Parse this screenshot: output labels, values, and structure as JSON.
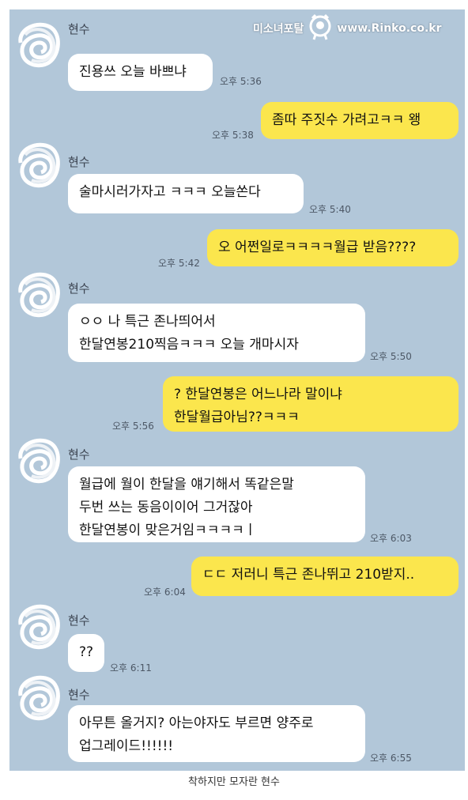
{
  "watermark": {
    "site": "미소녀포탈",
    "url": "www.Rinko.co.kr",
    "icon": "mascot-face-icon"
  },
  "colors": {
    "background": "#b2c7d9",
    "incoming": "#ffffff",
    "outgoing": "#fbe64d"
  },
  "messages": [
    {
      "sender": "현수",
      "text": "진용쓰 오늘 바쁘냐",
      "time": "오후 5:36"
    },
    {
      "text": "좀따 주짓수 가려고ㅋㅋ 왱",
      "time": "오후 5:38"
    },
    {
      "sender": "현수",
      "text": "술마시러가자고 ㅋㅋㅋ 오늘쏜다",
      "time": "오후 5:40"
    },
    {
      "text": "오 어쩐일로ㅋㅋㅋㅋ월급 받음????",
      "time": "오후 5:42"
    },
    {
      "sender": "현수",
      "text": "ㅇㅇ 나 특근 존나띄어서\n한달연봉210찍음ㅋㅋㅋ 오늘 개마시자",
      "time": "오후 5:50"
    },
    {
      "text": "? 한달연봉은 어느나라 말이냐\n한달월급아님??ㅋㅋㅋ",
      "time": "오후 5:56"
    },
    {
      "sender": "현수",
      "text": "월급에 월이 한달을 얘기해서 똑같은말\n두번 쓰는 동음이이어 그거잖아\n한달연봉이 맞은거임ㅋㅋㅋㅋㅣ",
      "time": "오후 6:03"
    },
    {
      "text": "ㄷㄷ 저러니 특근 존나뛰고 210받지..",
      "time": "오후 6:04"
    },
    {
      "sender": "현수",
      "text": "??",
      "time": "오후 6:11"
    },
    {
      "sender": "현수",
      "text": "아무튼 올거지? 아는야자도 부르면 양주로\n업그레이드!!!!!!",
      "time": "오후 6:55"
    }
  ],
  "caption": "착하지만 모자란 현수"
}
